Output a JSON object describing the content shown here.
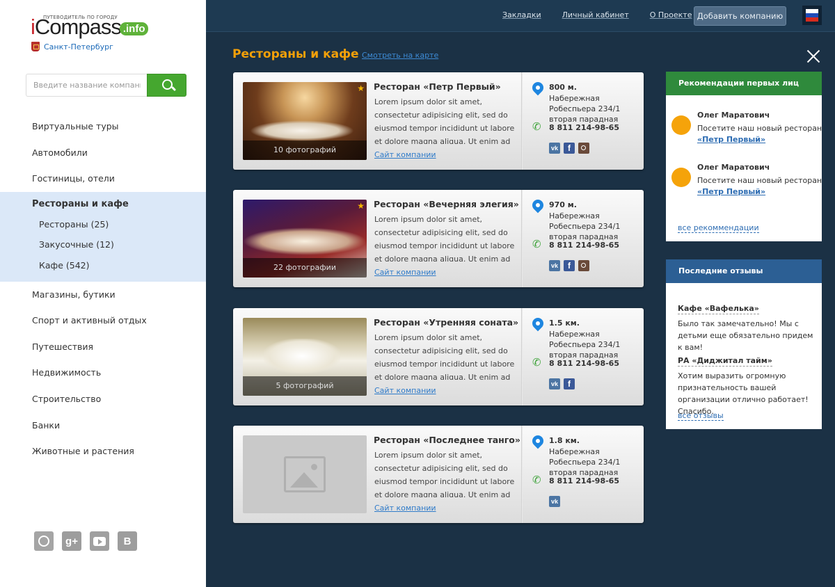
{
  "sidebar": {
    "logo_tagline": "ПУТЕВОДИТЕЛЬ ПО ГОРОДУ",
    "logo_text": "Compass",
    "logo_i": "i",
    "logo_suffix": ".info",
    "city": "Санкт-Петербург",
    "search_placeholder": "Введите название компании",
    "menu": [
      "Виртуальные туры",
      "Автомобили",
      "Гостиницы, отели",
      "Магазины, бутики",
      "Спорт и активный отдых",
      "Путешествия",
      "Недвижимость",
      "Строительство",
      "Банки",
      "Животные и растения"
    ],
    "active_group": {
      "title": "Рестораны и кафе",
      "subitems": [
        "Рестораны (25)",
        "Закусочные (12)",
        "Кафе (542)"
      ]
    },
    "socials": [
      "instagram-icon",
      "google-plus-icon",
      "youtube-icon",
      "vk-icon"
    ],
    "social_gplus": "g+",
    "social_vk": "B"
  },
  "header": {
    "links": [
      "Закладки",
      "Личный кабинет",
      "О Проекте"
    ],
    "add_company": "Добавить компанию",
    "flag_colors": [
      "#ffffff",
      "#1e4bb8",
      "#d52b1e"
    ]
  },
  "main": {
    "title": "Рестораны и кафе",
    "map_link": "Смотреть на карте",
    "listings": [
      {
        "name": "Ресторан «Петр Первый»",
        "description": "Lorem ipsum dolor sit amet, consectetur adipisicing elit, sed do eiusmod tempor incididunt ut labore et dolore magna aliqua. Ut enim ad minim veniam, quis",
        "site": "Сайт компании",
        "photos": "10 фотографий",
        "starred": true,
        "distance": "800 м.",
        "address": "Набережная Робеспьера 234/1 вторая парадная",
        "phone": "8 811 214-98-65",
        "networks": [
          "vk",
          "fb",
          "ig"
        ]
      },
      {
        "name": "Ресторан «Вечерняя элегия»",
        "description": "Lorem ipsum dolor sit amet, consectetur adipisicing elit, sed do eiusmod tempor incididunt ut labore et dolore magna aliqua. Ut enim ad minim veniam, quis nostrud",
        "site": "Сайт компании",
        "photos": "22 фотографии",
        "starred": true,
        "distance": "970 м.",
        "address": "Набережная Робеспьера 234/1 вторая парадная",
        "phone": "8 811 214-98-65",
        "networks": [
          "vk",
          "fb",
          "ig"
        ]
      },
      {
        "name": "Ресторан «Утренняя соната»",
        "description": "Lorem ipsum dolor sit amet, consectetur adipisicing elit, sed do eiusmod tempor incididunt ut labore et dolore magna aliqua. Ut enim ad minim veniam, quis",
        "site": "Сайт компании",
        "photos": "5 фотографий",
        "starred": false,
        "distance": "1.5 км.",
        "address": "Набережная Робеспьера 234/1 вторая парадная",
        "phone": "8 811 214-98-65",
        "networks": [
          "vk",
          "fb"
        ]
      },
      {
        "name": "Ресторан «Последнее танго»",
        "description": "Lorem ipsum dolor sit amet, consectetur adipisicing elit, sed do eiusmod tempor incididunt ut labore et dolore magna aliqua. Ut enim ad minim veniam, quis",
        "site": "Сайт компании",
        "photos": "",
        "starred": false,
        "distance": "1.8 км.",
        "address": "Набережная Робеспьера 234/1 вторая парадная",
        "phone": "8 811 214-98-65",
        "networks": [
          "vk"
        ]
      }
    ]
  },
  "recommendations": {
    "title": "Рекомендации первых лиц",
    "header_color": "#2f8a3c",
    "items": [
      {
        "name": "Олег Маратович",
        "text": "Посетите наш новый ресторан",
        "link": "«Петр Первый»"
      },
      {
        "name": "Олег Маратович",
        "text": "Посетите наш новый ресторан",
        "link": "«Петр Первый»"
      }
    ],
    "all_link": "все рекоммендации"
  },
  "reviews": {
    "title": "Последние отзывы",
    "header_color": "#2c5f94",
    "items": [
      {
        "title": "Кафе «Вафелька»",
        "text": "Было так замечательно! Мы с детьми еще обязательно придем к вам!"
      },
      {
        "title": "РА «Диджитал тайм»",
        "text": "Хотим выразить огромную признательность вашей организации отлично работает! Спасибо."
      }
    ],
    "all_link": "все отзывы"
  }
}
